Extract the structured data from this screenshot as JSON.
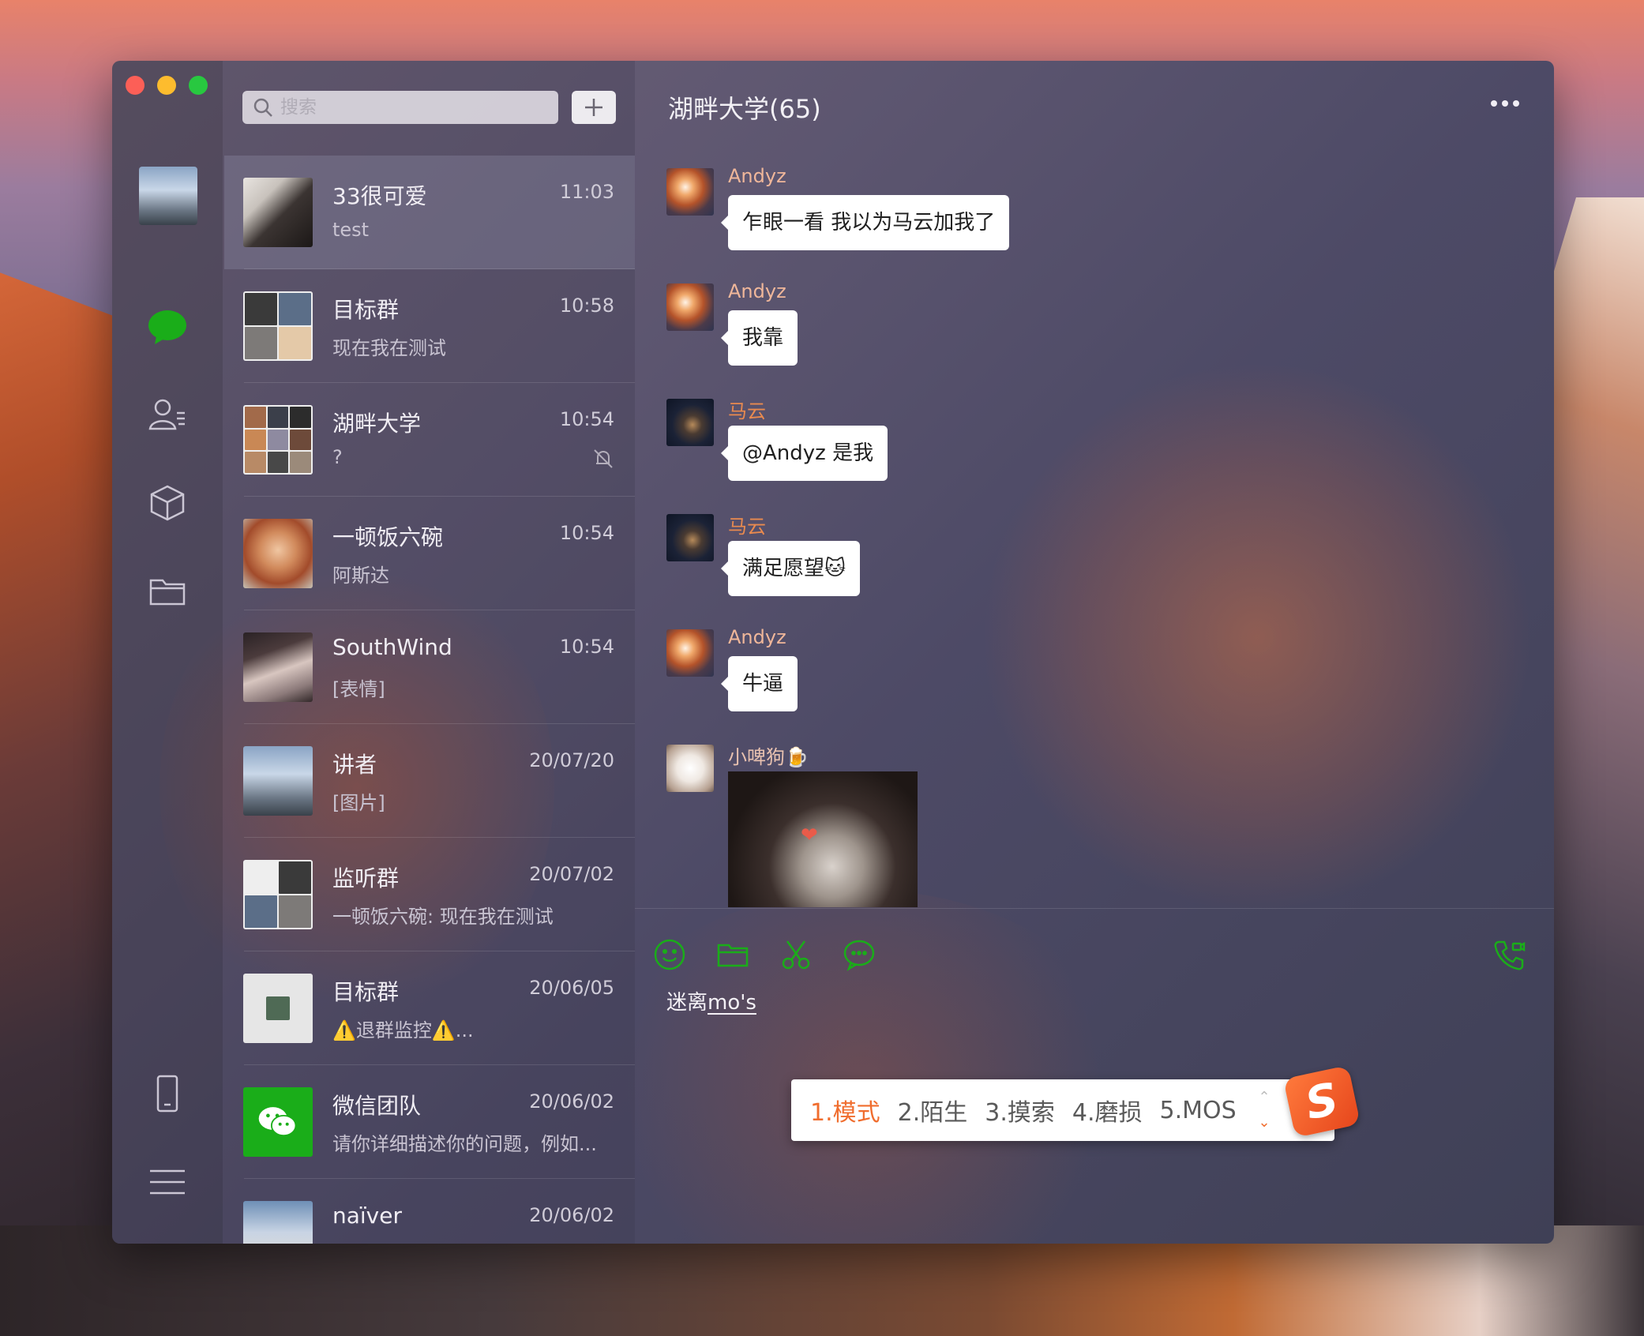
{
  "window": {
    "title": "湖畔大学(65)"
  },
  "search": {
    "placeholder": "搜索"
  },
  "rail": {
    "icons": [
      "chat-bubble-icon",
      "contacts-icon",
      "cube-icon",
      "folder-icon",
      "phone-icon",
      "menu-icon"
    ]
  },
  "chats": [
    {
      "name": "33很可爱",
      "time": "11:03",
      "preview": "test"
    },
    {
      "name": "目标群",
      "time": "10:58",
      "preview": "现在我在测试"
    },
    {
      "name": "湖畔大学",
      "time": "10:54",
      "preview": "?"
    },
    {
      "name": "一顿饭六碗",
      "time": "10:54",
      "preview": "阿斯达"
    },
    {
      "name": "SouthWind",
      "time": "10:54",
      "preview": "[表情]"
    },
    {
      "name": "讲者",
      "time": "20/07/20",
      "preview": "[图片]"
    },
    {
      "name": "监听群",
      "time": "20/07/02",
      "preview": "一顿饭六碗: 现在我在测试"
    },
    {
      "name": "目标群",
      "time": "20/06/05",
      "preview": "⚠️退群监控⚠️..."
    },
    {
      "name": "微信团队",
      "time": "20/06/02",
      "preview": "请你详细描述你的问题，例如..."
    },
    {
      "name": "naïver",
      "time": "20/06/02",
      "preview": ""
    }
  ],
  "messages": [
    {
      "sender": "Andyz",
      "text": "乍眼一看 我以为马云加我了"
    },
    {
      "sender": "Andyz",
      "text": "我靠"
    },
    {
      "sender": "马云",
      "text": "@Andyz 是我"
    },
    {
      "sender": "马云",
      "text": "满足愿望🐱"
    },
    {
      "sender": "Andyz",
      "text": "牛逼"
    },
    {
      "sender": "小啤狗🍺",
      "text": "",
      "sticker": "❤"
    }
  ],
  "compose": {
    "prefix": "迷离",
    "typed": "mo's"
  },
  "ime": {
    "candidates": [
      "1.模式",
      "2.陌生",
      "3.摸索",
      "4.磨损",
      "5.MOS"
    ],
    "logo": "S"
  },
  "colors": {
    "accent_green": "#1aad19",
    "ime_orange": "#f06d2e"
  }
}
